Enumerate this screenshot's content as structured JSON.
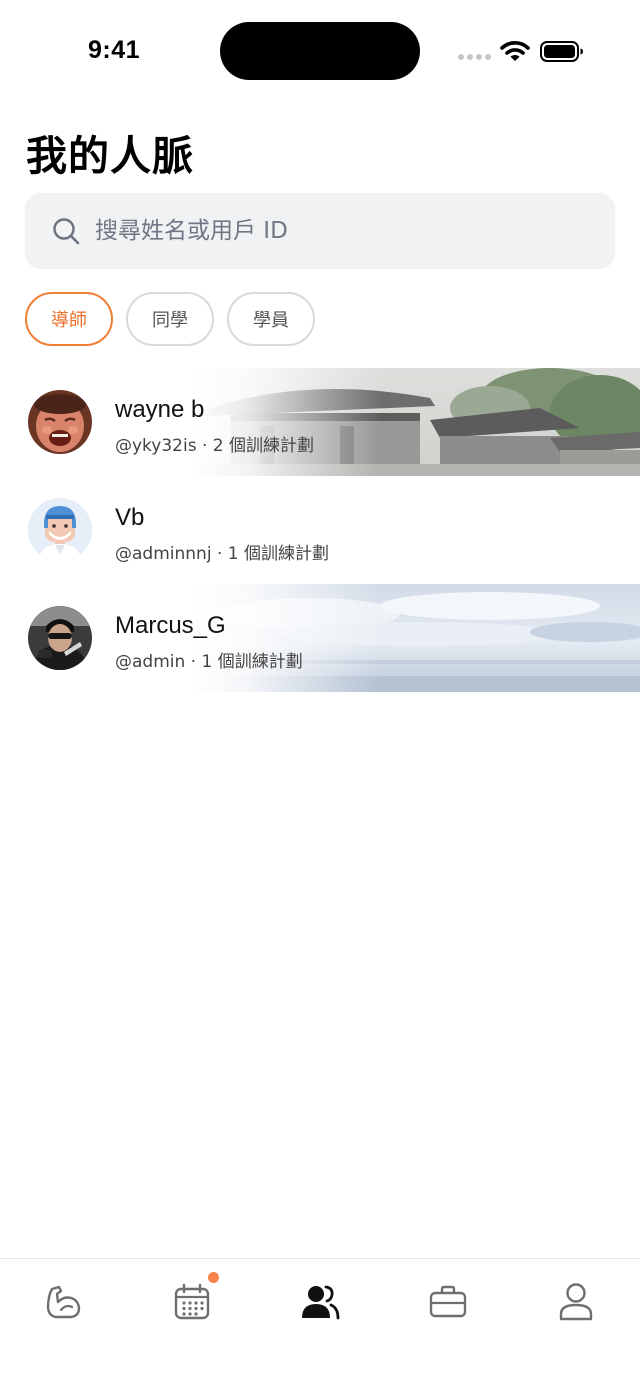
{
  "status_bar": {
    "time": "9:41"
  },
  "header": {
    "title": "我的人脈"
  },
  "search": {
    "placeholder": "搜尋姓名或用戶 ID",
    "value": ""
  },
  "filters": [
    {
      "label": "導師",
      "active": true
    },
    {
      "label": "同學",
      "active": false
    },
    {
      "label": "學員",
      "active": false
    }
  ],
  "contacts": [
    {
      "name": "wayne b",
      "meta": "@yky32is · 2 個訓練計劃",
      "background": "temple-photo"
    },
    {
      "name": "Vb",
      "meta": "@adminnnj · 1 個訓練計劃",
      "background": "none"
    },
    {
      "name": "Marcus_G",
      "meta": "@admin · 1 個訓練計劃",
      "background": "sky-photo"
    }
  ],
  "tab_bar": {
    "tabs": [
      {
        "icon": "muscle-arm-icon",
        "active": false
      },
      {
        "icon": "calendar-icon",
        "active": false,
        "badge": true
      },
      {
        "icon": "people-icon",
        "active": true
      },
      {
        "icon": "briefcase-icon",
        "active": false
      },
      {
        "icon": "profile-icon",
        "active": false
      }
    ]
  },
  "colors": {
    "accent": "#f07e36",
    "badge": "#f7824a",
    "search_bg": "#f1f2f4"
  }
}
